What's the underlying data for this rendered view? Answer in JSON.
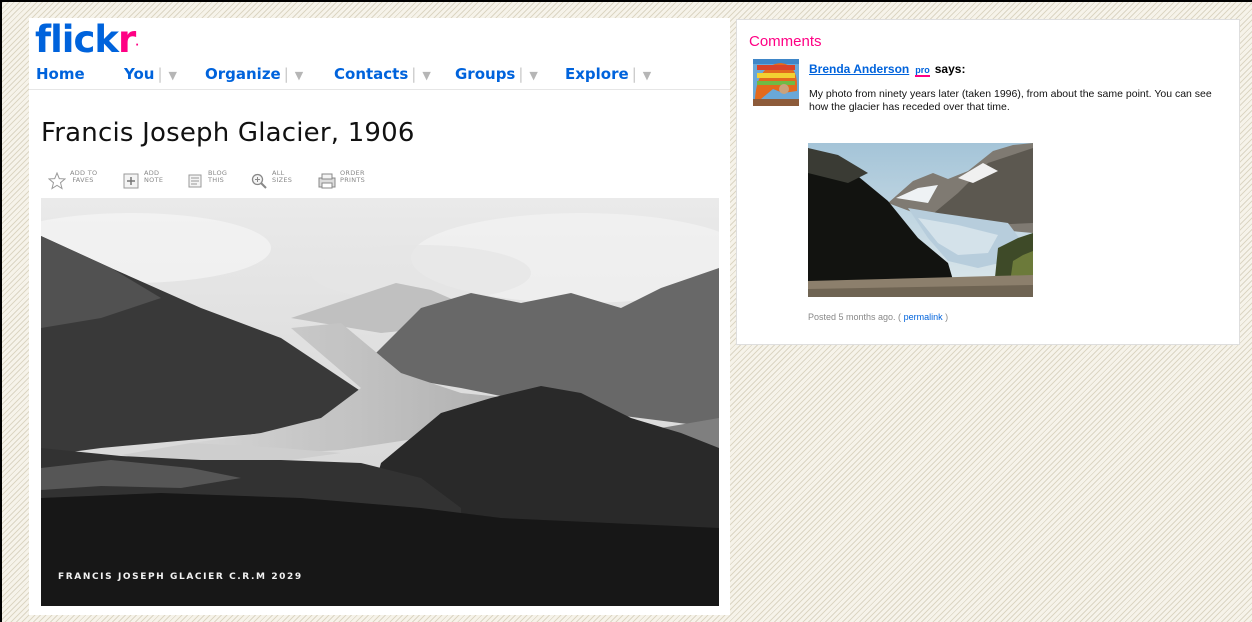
{
  "logo": {
    "part1": "flick",
    "part2": "r",
    "dot": "·"
  },
  "nav": [
    {
      "label": "Home"
    },
    {
      "label": "You"
    },
    {
      "label": "Organize"
    },
    {
      "label": "Contacts"
    },
    {
      "label": "Groups"
    },
    {
      "label": "Explore"
    }
  ],
  "photo": {
    "title": "Francis Joseph Glacier, 1906",
    "caption": "FRANCIS JOSEPH GLACIER C.R.M 2029"
  },
  "toolbar": [
    {
      "icon": "star-icon",
      "label": "ADD TO\n FAVES"
    },
    {
      "icon": "note-icon",
      "label": "ADD\nNOTE"
    },
    {
      "icon": "blog-icon",
      "label": "BLOG\nTHIS"
    },
    {
      "icon": "magnifier-icon",
      "label": "ALL\nSIZES"
    },
    {
      "icon": "prints-icon",
      "label": "ORDER\nPRINTS"
    }
  ],
  "comments": {
    "heading": "Comments",
    "author": "Brenda Anderson",
    "badge": "pro",
    "says": "says:",
    "text": "My photo from ninety years later (taken 1996), from about the same point. You can see how the glacier has receded over that time.",
    "posted_prefix": "Posted 5 months ago. (",
    "permalink": "permalink",
    "posted_suffix": ")"
  },
  "colors": {
    "flickr_blue": "#0063dc",
    "flickr_pink": "#ff0084"
  }
}
